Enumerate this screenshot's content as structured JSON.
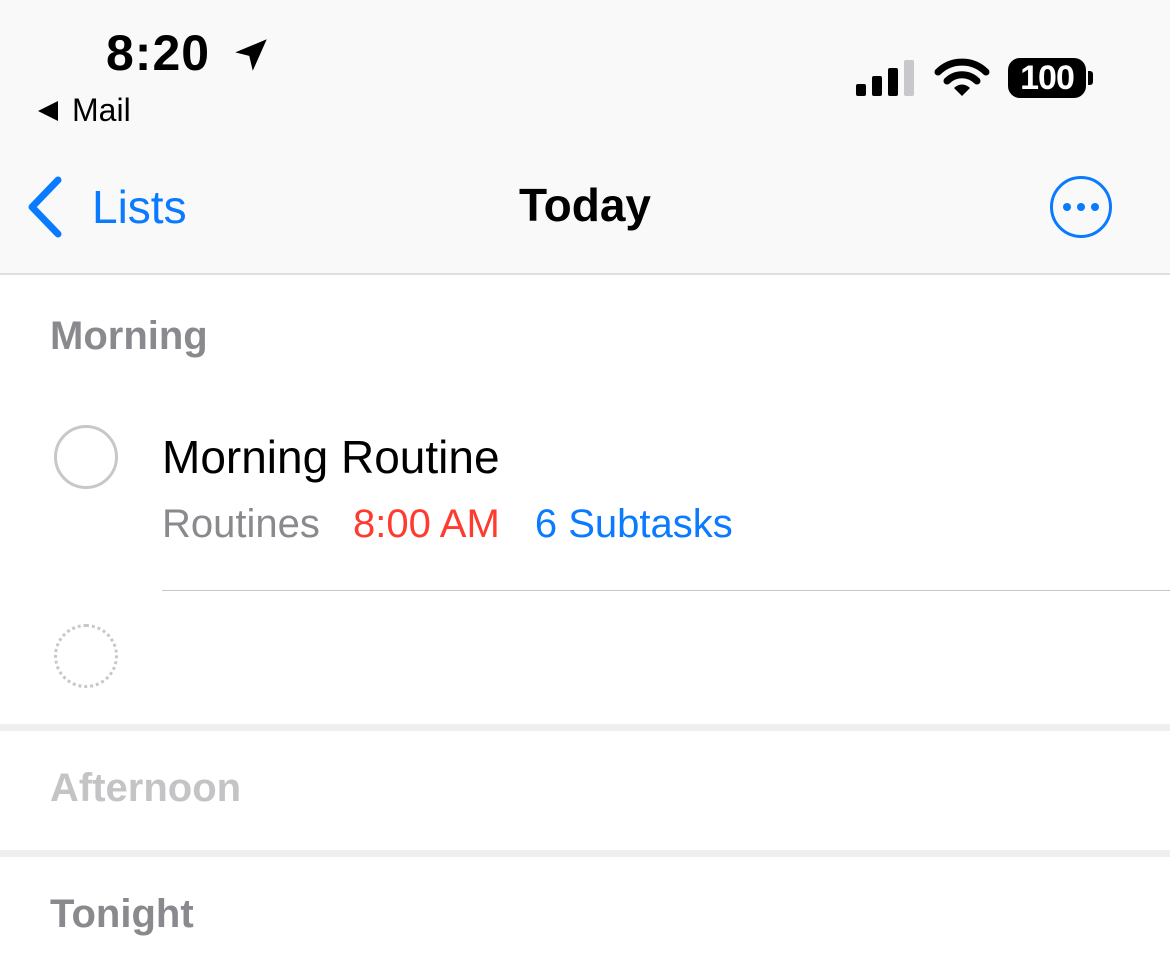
{
  "status_bar": {
    "time": "8:20",
    "back_app": "Mail",
    "battery": "100",
    "icons": [
      "location-arrow-icon",
      "cellular-signal-icon",
      "wifi-icon",
      "battery-icon"
    ]
  },
  "nav": {
    "back_label": "Lists",
    "title": "Today",
    "more_icon": "ellipsis-circle-icon"
  },
  "sections": {
    "morning": {
      "header": "Morning",
      "tasks": [
        {
          "title": "Morning Routine",
          "list": "Routines",
          "due": "8:00 AM",
          "subtasks": "6 Subtasks"
        }
      ]
    },
    "afternoon": {
      "header": "Afternoon"
    },
    "tonight": {
      "header": "Tonight"
    }
  },
  "colors": {
    "accent": "#0a7aff",
    "due": "#ff3b30",
    "secondary": "#8a8a8e"
  }
}
